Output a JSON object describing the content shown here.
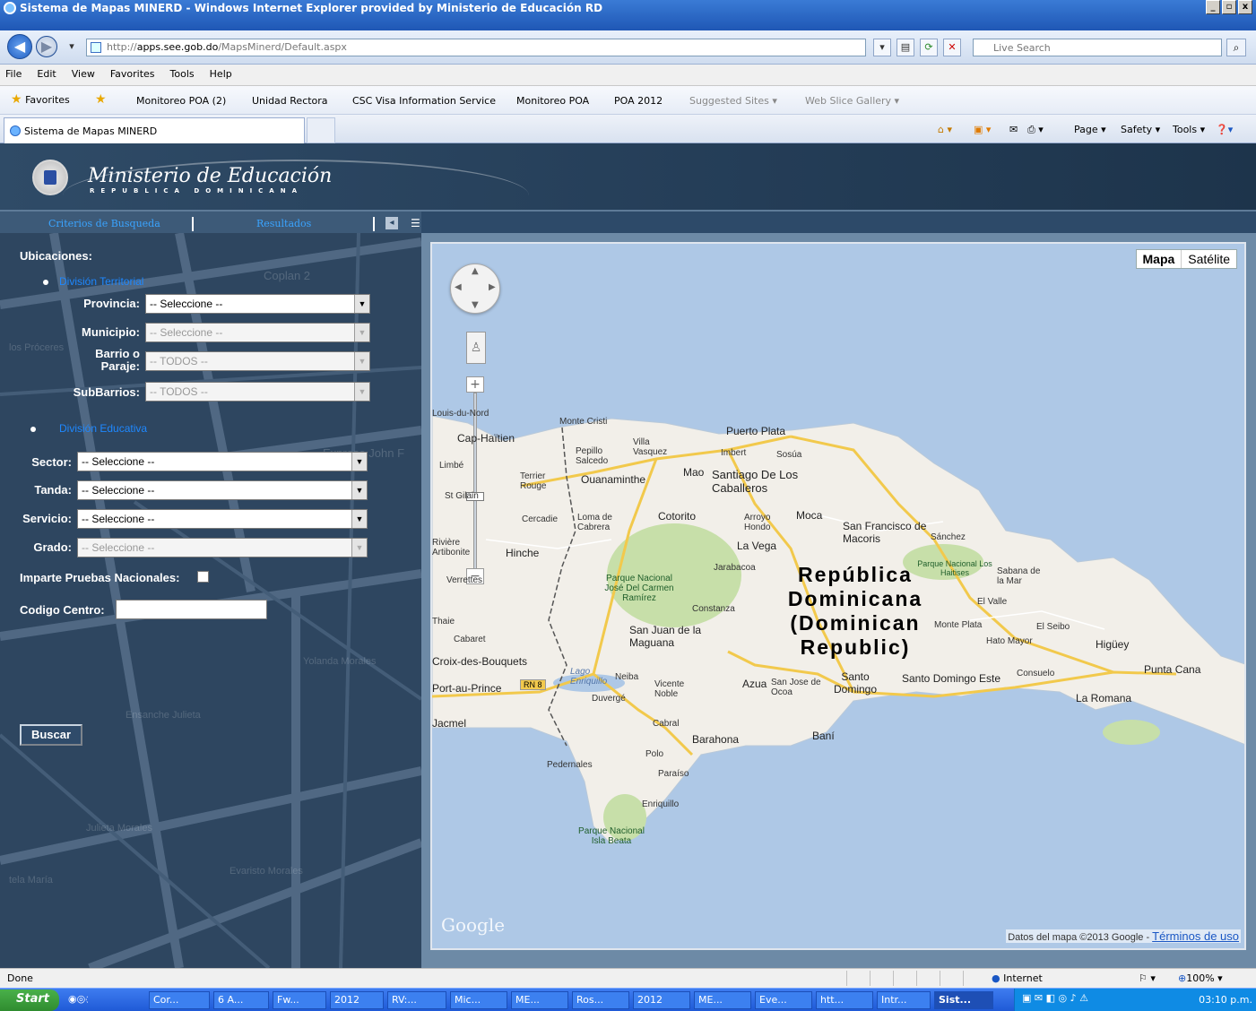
{
  "window": {
    "title": "Sistema de Mapas MINERD - Windows Internet Explorer provided by Ministerio de Educación RD",
    "controls": [
      "_",
      "▫",
      "x"
    ]
  },
  "address": {
    "url_prefix": "http://",
    "url_host": "apps.see.gob.do",
    "url_path": "/MapsMinerd/Default.aspx",
    "search_placeholder": "Live Search"
  },
  "menu": [
    "File",
    "Edit",
    "View",
    "Favorites",
    "Tools",
    "Help"
  ],
  "favorites_bar": {
    "label": "Favorites",
    "items": [
      "Monitoreo POA (2)",
      "Unidad Rectora",
      "CSC Visa Information Service",
      "Monitoreo POA",
      "POA 2012",
      "Suggested Sites ▾",
      "Web Slice Gallery ▾"
    ]
  },
  "browser_tab": {
    "label": "Sistema de Mapas MINERD"
  },
  "command_bar": [
    "Page ▾",
    "Safety ▾",
    "Tools ▾"
  ],
  "site": {
    "ministry_name": "Ministerio de Educación",
    "ministry_sub": "REPUBLICA DOMINICANA",
    "tabs": [
      "Criterios de Busqueda",
      "Resultados"
    ]
  },
  "form": {
    "locations_title": "Ubicaciones:",
    "territorial_title": "División Territorial",
    "educational_title": "División Educativa",
    "fields": {
      "provincia": {
        "label": "Provincia:",
        "value": "-- Seleccione --"
      },
      "municipio": {
        "label": "Municipio:",
        "value": "-- Seleccione --"
      },
      "barrio": {
        "label": "Barrio o Paraje:",
        "value": "-- TODOS --"
      },
      "subbarrios": {
        "label": "SubBarrios:",
        "value": "-- TODOS --"
      },
      "sector": {
        "label": "Sector:",
        "value": "-- Seleccione --"
      },
      "tanda": {
        "label": "Tanda:",
        "value": "-- Seleccione --"
      },
      "servicio": {
        "label": "Servicio:",
        "value": "-- Seleccione --"
      },
      "grado": {
        "label": "Grado:",
        "value": "-- Seleccione --"
      }
    },
    "pruebas_label": "Imparte Pruebas Nacionales:",
    "codigo_label": "Codigo Centro:",
    "codigo_value": "",
    "submit": "Buscar"
  },
  "map": {
    "type_buttons": [
      "Mapa",
      "Satélite"
    ],
    "country_label": "República Dominicana (Dominican Republic)",
    "places": [
      "Louis-du-Nord",
      "Monte Cristi",
      "Puerto Plata",
      "Cap-Haïtien",
      "Villa Vasquez",
      "Pepillo Salcedo",
      "Imbert",
      "Sosúa",
      "Limbé",
      "Terrier Rouge",
      "Ouanaminthe",
      "Mao",
      "Santiago De Los Caballeros",
      "St Gilain",
      "Cercadie",
      "Loma de Cabrera",
      "Cotorito",
      "Arroyo Hondo",
      "Moca",
      "San Francisco de Macoris",
      "Sánchez",
      "Rivière Artibonite",
      "Hinche",
      "La Vega",
      "Jarabacoa",
      "Parque Nacional José Del Carmen Ramírez",
      "Parque Nacional Los Haitises",
      "Sabana de la Mar",
      "Verrettes",
      "Constanza",
      "El Valle",
      "Monte Plata",
      "El Seibo",
      "Hato Mayor",
      "Higüey",
      "Punta Cana",
      "Cabaret",
      "San Juan de la Maguana",
      "Croix-des-Bouquets",
      "Lago Enriquillo",
      "Neiba",
      "Vicente Noble",
      "Duvergé",
      "Azua",
      "San Jose de Ocoa",
      "Santo Domingo",
      "Santo Domingo Este",
      "Consuelo",
      "La Romana",
      "Port-au-Prince",
      "Cabral",
      "Barahona",
      "Baní",
      "Polo",
      "Paraíso",
      "Pedernales",
      "Enriquillo",
      "Parque Nacional Isla Beata",
      "Jacmel",
      "Thaie"
    ],
    "route_badge": "RN 8",
    "attribution": "Datos del mapa ©2013 Google - ",
    "terms_link": "Términos de uso",
    "logo": "Google",
    "colors": {
      "water": "#aec8e6",
      "land": "#f2efe9",
      "park": "#c7dfa9",
      "road": "#f2c94c",
      "border": "#555555"
    }
  },
  "status": {
    "left": "Done",
    "zone": "Internet",
    "zoom": "100%"
  },
  "taskbar": {
    "start": "Start",
    "tasks": [
      "Cor...",
      "6 A...",
      "Fw...",
      "2012",
      "RV:...",
      "Mic...",
      "ME...",
      "Ros...",
      "2012",
      "ME...",
      "Eve...",
      "htt...",
      "Intr...",
      "Sist..."
    ],
    "clock": "03:10 p.m."
  }
}
